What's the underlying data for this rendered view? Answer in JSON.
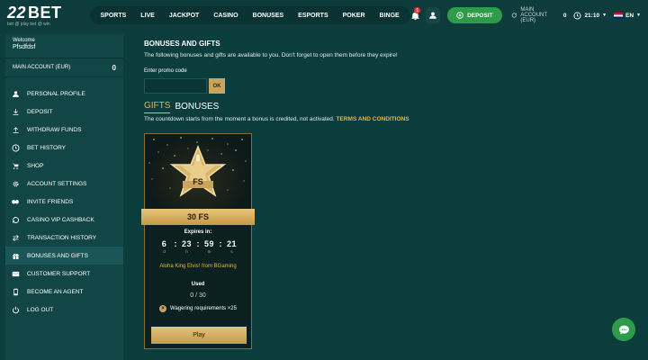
{
  "header": {
    "logo_22": "22",
    "logo_bet": "BET",
    "logo_tagline": "bet @ play  bet @ win",
    "nav": [
      "SPORTS",
      "LIVE",
      "JACKPOT",
      "CASINO",
      "BONUSES",
      "ESPORTS",
      "POKER",
      "BINGE"
    ],
    "notification_count": "1",
    "deposit_label": "DEPOSIT",
    "main_account_label": "MAIN ACCOUNT (EUR)",
    "main_account_value": "0",
    "time": "21:10",
    "language": "EN"
  },
  "sidebar": {
    "welcome_label": "Welcome",
    "username": "Pfsdfdsf",
    "main_account_label": "MAIN ACCOUNT (EUR)",
    "main_account_value": "0",
    "items": [
      {
        "label": "PERSONAL PROFILE",
        "icon": "user-icon"
      },
      {
        "label": "DEPOSIT",
        "icon": "download-icon"
      },
      {
        "label": "WITHDRAW FUNDS",
        "icon": "upload-icon"
      },
      {
        "label": "BET HISTORY",
        "icon": "clock-icon"
      },
      {
        "label": "SHOP",
        "icon": "cart-icon"
      },
      {
        "label": "ACCOUNT SETTINGS",
        "icon": "gear-icon"
      },
      {
        "label": "INVITE FRIENDS",
        "icon": "handshake-icon"
      },
      {
        "label": "CASINO VIP CASHBACK",
        "icon": "cashback-icon"
      },
      {
        "label": "TRANSACTION HISTORY",
        "icon": "transfer-icon"
      },
      {
        "label": "BONUSES AND GIFTS",
        "icon": "gift-icon"
      },
      {
        "label": "CUSTOMER SUPPORT",
        "icon": "mail-icon"
      },
      {
        "label": "BECOME AN AGENT",
        "icon": "agent-icon"
      },
      {
        "label": "LOG OUT",
        "icon": "power-icon"
      }
    ],
    "active_index": 9
  },
  "main": {
    "title": "BONUSES AND GIFTS",
    "subtitle": "The following bonuses and gifts are available to you. Don't forget to open them before they expire!",
    "promo_label": "Enter promo code",
    "promo_placeholder": "",
    "promo_ok": "OK",
    "tab_gifts": "GIFTS",
    "tab_bonuses": "BONUSES",
    "countdown_note": "The countdown starts from the moment a bonus is credited, not activated.",
    "terms_link": "TERMS AND CONDITIONS"
  },
  "card": {
    "badge": "FS",
    "ribbon": "30 FS",
    "expires_label": "Expires in:",
    "timer": [
      {
        "value": "6",
        "unit": "d"
      },
      {
        "value": "23",
        "unit": "h"
      },
      {
        "value": "59",
        "unit": "m"
      },
      {
        "value": "21",
        "unit": "s"
      }
    ],
    "game": "Aloha King Elvis! from BGaming",
    "used_label": "Used",
    "used_value": "0 / 30",
    "wager_icon": "×",
    "wager_text": "Wagering requirements ×25",
    "play_label": "Play"
  },
  "colors": {
    "background": "#0c3d3d",
    "sidebar": "#124545",
    "accent_gold": "#e8b547",
    "deposit_green": "#2e9b4a"
  }
}
